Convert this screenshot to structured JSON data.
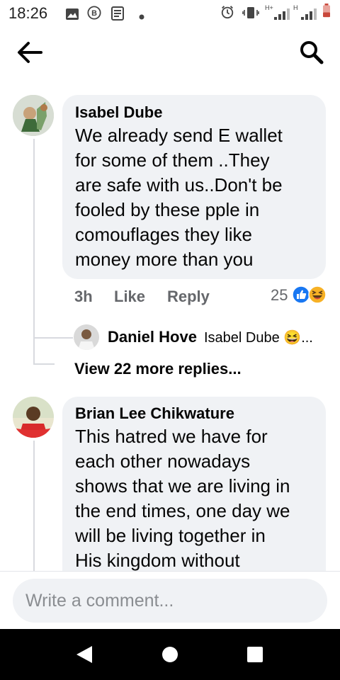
{
  "status_bar": {
    "time": "18:26",
    "icons": [
      "gallery-icon",
      "b-badge-icon",
      "news-icon",
      "dot-icon",
      "alarm-icon",
      "vibrate-icon",
      "signal-icon",
      "signal-icon",
      "battery-low-icon"
    ],
    "network_label_1": "H+",
    "network_label_2": "H"
  },
  "header": {
    "icons": [
      "back-arrow-icon",
      "search-icon"
    ]
  },
  "comments": [
    {
      "author": "Isabel Dube",
      "text_lines": [
        "We already send  E wallet",
        "for some of them ..They",
        "are safe with us..Don't be",
        "fooled by these pple in",
        "comouflages they like",
        "money more than you"
      ],
      "time": "3h",
      "like_label": "Like",
      "reply_label": "Reply",
      "reaction_count": "25",
      "reactions": [
        "like-reaction-icon",
        "haha-reaction-icon"
      ],
      "reply_preview": {
        "author": "Daniel Hove",
        "text": "Isabel Dube 😆..."
      },
      "more_replies": "View 22 more replies..."
    },
    {
      "author": "Brian Lee Chikwature",
      "text_lines": [
        "This hatred we have for",
        "each other nowadays",
        "shows that we are living in",
        "the end times, one day we",
        "will be living together in",
        "His kingdom without"
      ]
    }
  ],
  "composer": {
    "placeholder": "Write a comment..."
  },
  "nav": {
    "icons": [
      "back-triangle-icon",
      "home-circle-icon",
      "recents-square-icon"
    ]
  },
  "colors": {
    "bubble": "#f0f2f5",
    "meta": "#65676b",
    "like_blue": "#1877f2",
    "haha_yellow": "#f7b125"
  }
}
